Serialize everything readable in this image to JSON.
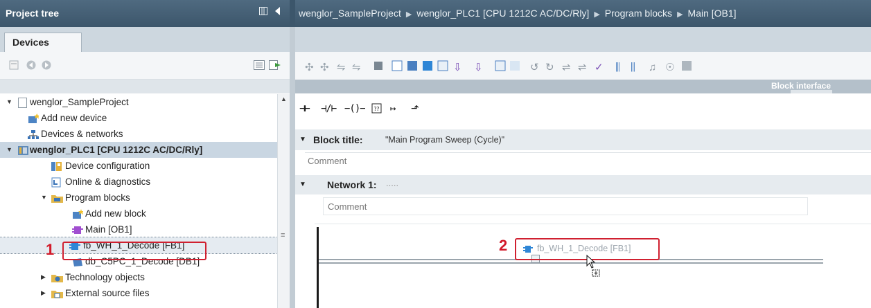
{
  "project_tree": {
    "title": "Project tree",
    "panel_icon": "panel-layout-icon",
    "collapse_icon": "collapse-left-icon",
    "tab_label": "Devices",
    "items": [
      {
        "label": "wenglor_SampleProject",
        "icon": "project-icon",
        "expanded": true
      },
      {
        "label": "Add new device",
        "icon": "add-device-icon"
      },
      {
        "label": "Devices & networks",
        "icon": "network-icon"
      },
      {
        "label": "wenglor_PLC1 [CPU 1212C AC/DC/Rly]",
        "icon": "plc-icon",
        "expanded": true
      },
      {
        "label": "Device configuration",
        "icon": "device-config-icon"
      },
      {
        "label": "Online & diagnostics",
        "icon": "diagnostics-icon"
      },
      {
        "label": "Program blocks",
        "icon": "folder-icon",
        "expanded": true
      },
      {
        "label": "Add new block",
        "icon": "add-block-icon"
      },
      {
        "label": "Main [OB1]",
        "icon": "ob-block-icon"
      },
      {
        "label": "fb_WH_1_Decode [FB1]",
        "icon": "fb-block-icon"
      },
      {
        "label": "db_C5PC_1_Decode [DB1]",
        "icon": "db-block-icon"
      },
      {
        "label": "Technology objects",
        "icon": "technology-icon",
        "expanded": false
      },
      {
        "label": "External source files",
        "icon": "source-files-icon",
        "expanded": false
      }
    ]
  },
  "breadcrumb": [
    "wenglor_SampleProject",
    "wenglor_PLC1 [CPU 1212C AC/DC/Rly]",
    "Program blocks",
    "Main [OB1]"
  ],
  "editor": {
    "block_interface_label": "Block interface",
    "block_title_label": "Block title:",
    "block_title_value": "\"Main Program Sweep (Cycle)\"",
    "comment_placeholder": "Comment",
    "network_label": "Network 1:",
    "network_dots": ".....",
    "network_comment_placeholder": "Comment",
    "dragged_block_label": "fb_WH_1_Decode [FB1]"
  },
  "annotations": {
    "step1": "1",
    "step2": "2",
    "color": "#d02030"
  }
}
